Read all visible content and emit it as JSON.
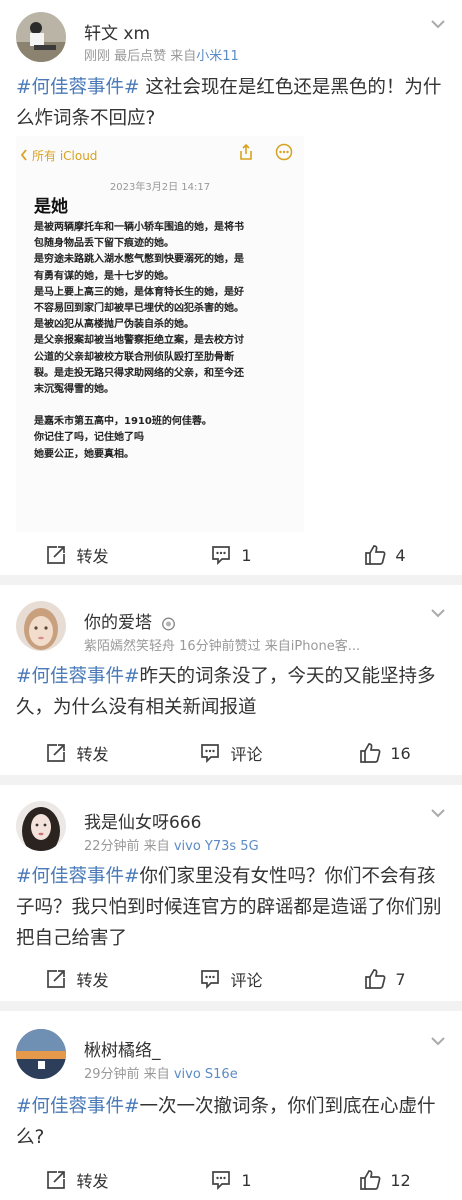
{
  "posts": [
    {
      "author": "轩文 xm",
      "meta_prefix": "刚刚 最后点赞 来自",
      "meta_source": "小米11",
      "tag": "#何佳蓉事件#",
      "text": " 这社会现在是红色还是黑色的！为什么炸词条不回应?",
      "share_label": "转发",
      "comment_label": "1",
      "like_label": "4",
      "note": {
        "back_label": "所有 iCloud",
        "date": "2023年3月2日 14:17",
        "title": "是她",
        "lines": [
          "是被两辆摩托车和一辆小轿车围追的她，是将书",
          "包随身物品丢下留下痕迹的她。",
          "是穷途未路跳入湖水憋气憋到快要溺死的她，是",
          "有勇有谋的她，是十七岁的她。",
          "是马上要上高三的她，是体育特长生的她，是好",
          "不容易回到家门却被早已埋伏的凶犯杀害的她。",
          "是被凶犯从高楼抛尸伪装自杀的她。",
          "是父亲报案却被当地警察拒绝立案，是去校方讨",
          "公道的父亲却被校方联合刑侦队殴打至肋骨断",
          "裂。是走投无路只得求助网络的父亲，和至今还",
          "末沉冤得雪的她。",
          "",
          "是嘉禾市第五高中，1910班的何佳蓉。",
          "你记住了吗，记住她了吗",
          "她要公正，她要真相。"
        ]
      }
    },
    {
      "author": "你的爱塔",
      "meta_prefix": "紫陌嫣然笑轻舟  16分钟前赞过  来自iPhone客...",
      "meta_source": "",
      "tag": "#何佳蓉事件#",
      "text": "昨天的词条没了，今天的又能坚持多久，为什么没有相关新闻报道",
      "share_label": "转发",
      "comment_label": "评论",
      "like_label": "16"
    },
    {
      "author": "我是仙女呀666",
      "meta_prefix": "22分钟前  来自",
      "meta_source": "vivo Y73s 5G",
      "tag": "#何佳蓉事件#",
      "text": "你们家里没有女性吗？你们不会有孩子吗？我只怕到时候连官方的辟谣都是造谣了你们别把自己给害了",
      "share_label": "转发",
      "comment_label": "评论",
      "like_label": "7"
    },
    {
      "author": "楸树橘络_",
      "meta_prefix": "29分钟前  来自",
      "meta_source": "vivo S16e",
      "tag": "#何佳蓉事件#",
      "text": "一次一次撤词条，你们到底在心虚什么?",
      "share_label": "转发",
      "comment_label": "1",
      "like_label": "12"
    }
  ],
  "colors": {
    "accent": "#4a7ab8",
    "source": "#5b8bc5",
    "meta": "#999999",
    "note_link": "#d8a220"
  }
}
